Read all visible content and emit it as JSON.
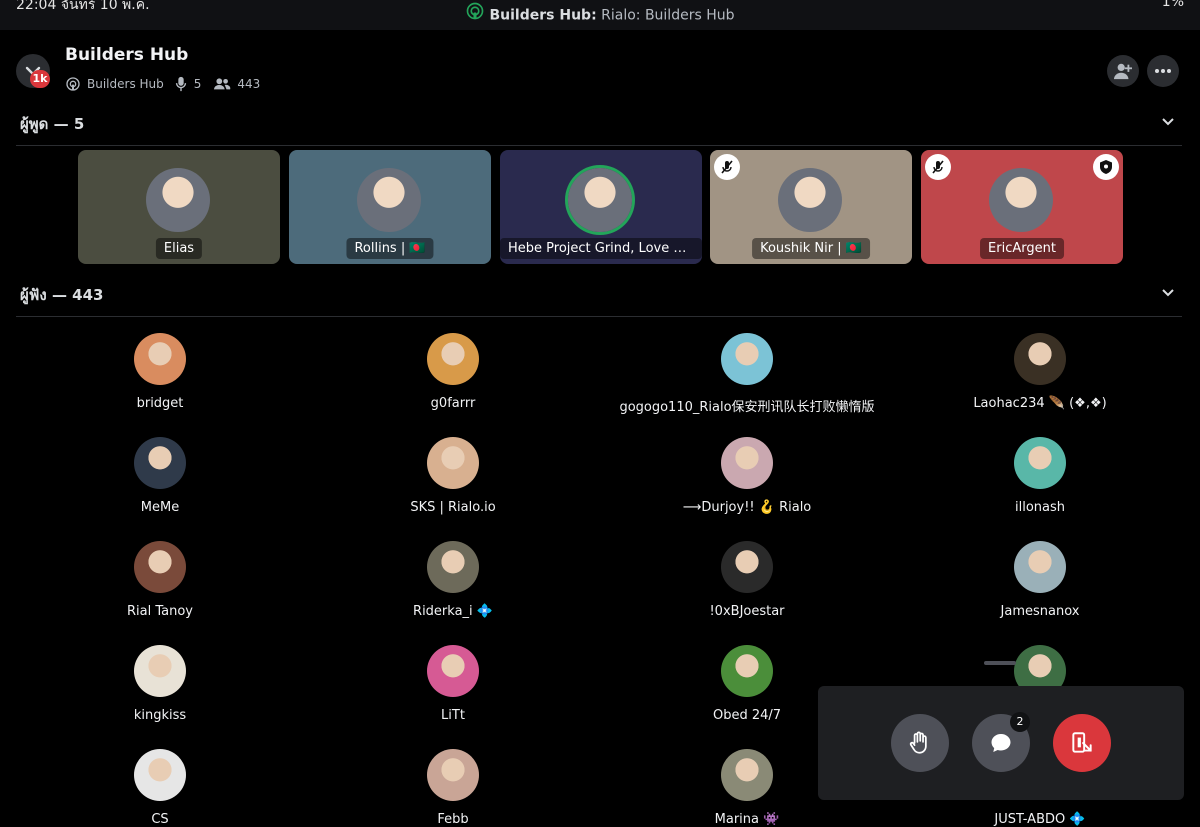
{
  "status_bar": {
    "time": "22:04",
    "date": "จันทร์ 10 พ.ค.",
    "right": "1%"
  },
  "stage_bar": {
    "server": "Builders Hub:",
    "channel": "Rialo: Builders Hub"
  },
  "header": {
    "title": "Builders Hub",
    "badge": "1k",
    "server_label": "Builders Hub",
    "speaker_count": "5",
    "listener_count": "443"
  },
  "speakers_section": {
    "label": "ผู้พูด — 5"
  },
  "listeners_section": {
    "label": "ผู้ฟัง — 443"
  },
  "speakers": [
    {
      "name": "Elias",
      "bg": "#4b4d40",
      "muted": false,
      "moderator": false
    },
    {
      "name": "Rollins | 🇧🇩",
      "bg": "#4d6b7b",
      "muted": false,
      "moderator": false
    },
    {
      "name": "Hebe Project Grind, Love B...",
      "bg": "#2a2a4e",
      "muted": false,
      "moderator": false
    },
    {
      "name": "Koushik Nir | 🇧🇩",
      "bg": "#a19484",
      "muted": true,
      "moderator": false
    },
    {
      "name": "EricArgent",
      "bg": "#bf474b",
      "muted": true,
      "moderator": true
    }
  ],
  "listeners": [
    {
      "name": "bridget",
      "color": "#d98c5f"
    },
    {
      "name": "g0farrr",
      "color": "#d89a49"
    },
    {
      "name": "gogogo110_Rialo保安刑讯队长打败懒惰版",
      "color": "#7cc3d6"
    },
    {
      "name": "Laohac234 🪶 (❖,❖)",
      "color": "#3a3024"
    },
    {
      "name": "MeMe",
      "color": "#2f3a4a"
    },
    {
      "name": "SKS | Rialo.io",
      "color": "#d8b090"
    },
    {
      "name": "⟶Durjoy!! 🪝 Rialo",
      "color": "#caa8b0"
    },
    {
      "name": "illonash",
      "color": "#59b7a8"
    },
    {
      "name": "Rial Tanoy",
      "color": "#7a4a3a"
    },
    {
      "name": "Riderka_i 💠",
      "color": "#6d6a5a"
    },
    {
      "name": "!0xBJoestar",
      "color": "#2a2a2a"
    },
    {
      "name": "Jamesnanox",
      "color": "#9ab0b8"
    },
    {
      "name": "kingkiss",
      "color": "#e8e2d6"
    },
    {
      "name": "LiTt",
      "color": "#d65a94"
    },
    {
      "name": "Obed 24/7",
      "color": "#4b8e3a"
    },
    {
      "name": "",
      "color": "#3e6e44"
    },
    {
      "name": "CS",
      "color": "#e6e6e6"
    },
    {
      "name": "Febb",
      "color": "#c9a596"
    },
    {
      "name": "Marina 👾",
      "color": "#8a8a76"
    },
    {
      "name": "JUST-ABDO 💠",
      "color": "#000000"
    }
  ],
  "controls": {
    "chat_badge": "2"
  },
  "colors": {
    "accent_red": "#da373c",
    "panel": "#1e1f22",
    "button_gray": "#4e5058"
  }
}
